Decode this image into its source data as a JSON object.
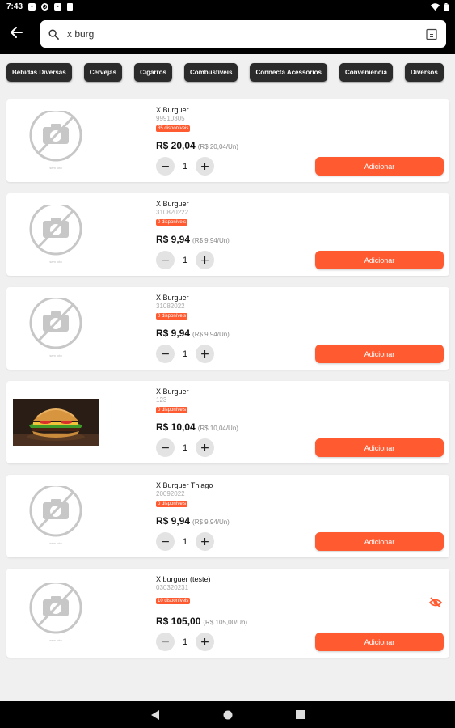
{
  "status_bar": {
    "time": "7:43",
    "icons": [
      "notification-icon",
      "settings-icon",
      "app-icon",
      "doc-icon",
      "wifi-icon",
      "battery-icon"
    ]
  },
  "search": {
    "value": "x burg",
    "placeholder": ""
  },
  "categories": [
    "Bebidas Diversas",
    "Cervejas",
    "Cigarros",
    "Combustíveis",
    "Connecta Acessorios",
    "Conveniencia",
    "Diversos"
  ],
  "products": [
    {
      "name": "X Burguer",
      "code": "99910305",
      "stock": "35 disponíveis",
      "price": "R$ 20,04",
      "unit_price": "(R$ 20,04/Un)",
      "qty": "1",
      "image": "placeholder",
      "add_label": "Adicionar"
    },
    {
      "name": "X Burguer",
      "code": "310820222",
      "stock": "0 disponíveis",
      "price": "R$ 9,94",
      "unit_price": "(R$ 9,94/Un)",
      "qty": "1",
      "image": "placeholder",
      "add_label": "Adicionar"
    },
    {
      "name": "X Burguer",
      "code": "31082022",
      "stock": "0 disponíveis",
      "price": "R$ 9,94",
      "unit_price": "(R$ 9,94/Un)",
      "qty": "1",
      "image": "placeholder",
      "add_label": "Adicionar"
    },
    {
      "name": "X Burguer",
      "code": "123",
      "stock": "0 disponíveis",
      "price": "R$ 10,04",
      "unit_price": "(R$ 10,04/Un)",
      "qty": "1",
      "image": "burger",
      "add_label": "Adicionar"
    },
    {
      "name": "X Burguer Thiago",
      "code": "20092022",
      "stock": "0 disponíveis",
      "price": "R$ 9,94",
      "unit_price": "(R$ 9,94/Un)",
      "qty": "1",
      "image": "placeholder",
      "add_label": "Adicionar"
    },
    {
      "name": "X burguer (teste)",
      "code": "030320231",
      "stock": "10 disponíveis",
      "price": "R$ 105,00",
      "unit_price": "(R$ 105,00/Un)",
      "qty": "1",
      "image": "placeholder",
      "add_label": "Adicionar",
      "hidden": true
    }
  ],
  "colors": {
    "accent": "#ff5a30",
    "chip_bg": "#2b2b2b",
    "appbar": "#000000",
    "page_bg": "#f0f0f0"
  },
  "icons": {
    "back": "arrow-left-icon",
    "search": "search-icon",
    "scan": "barcode-scan-icon",
    "hidden": "eye-off-icon",
    "nav": [
      "nav-back-icon",
      "nav-home-icon",
      "nav-recents-icon"
    ]
  }
}
